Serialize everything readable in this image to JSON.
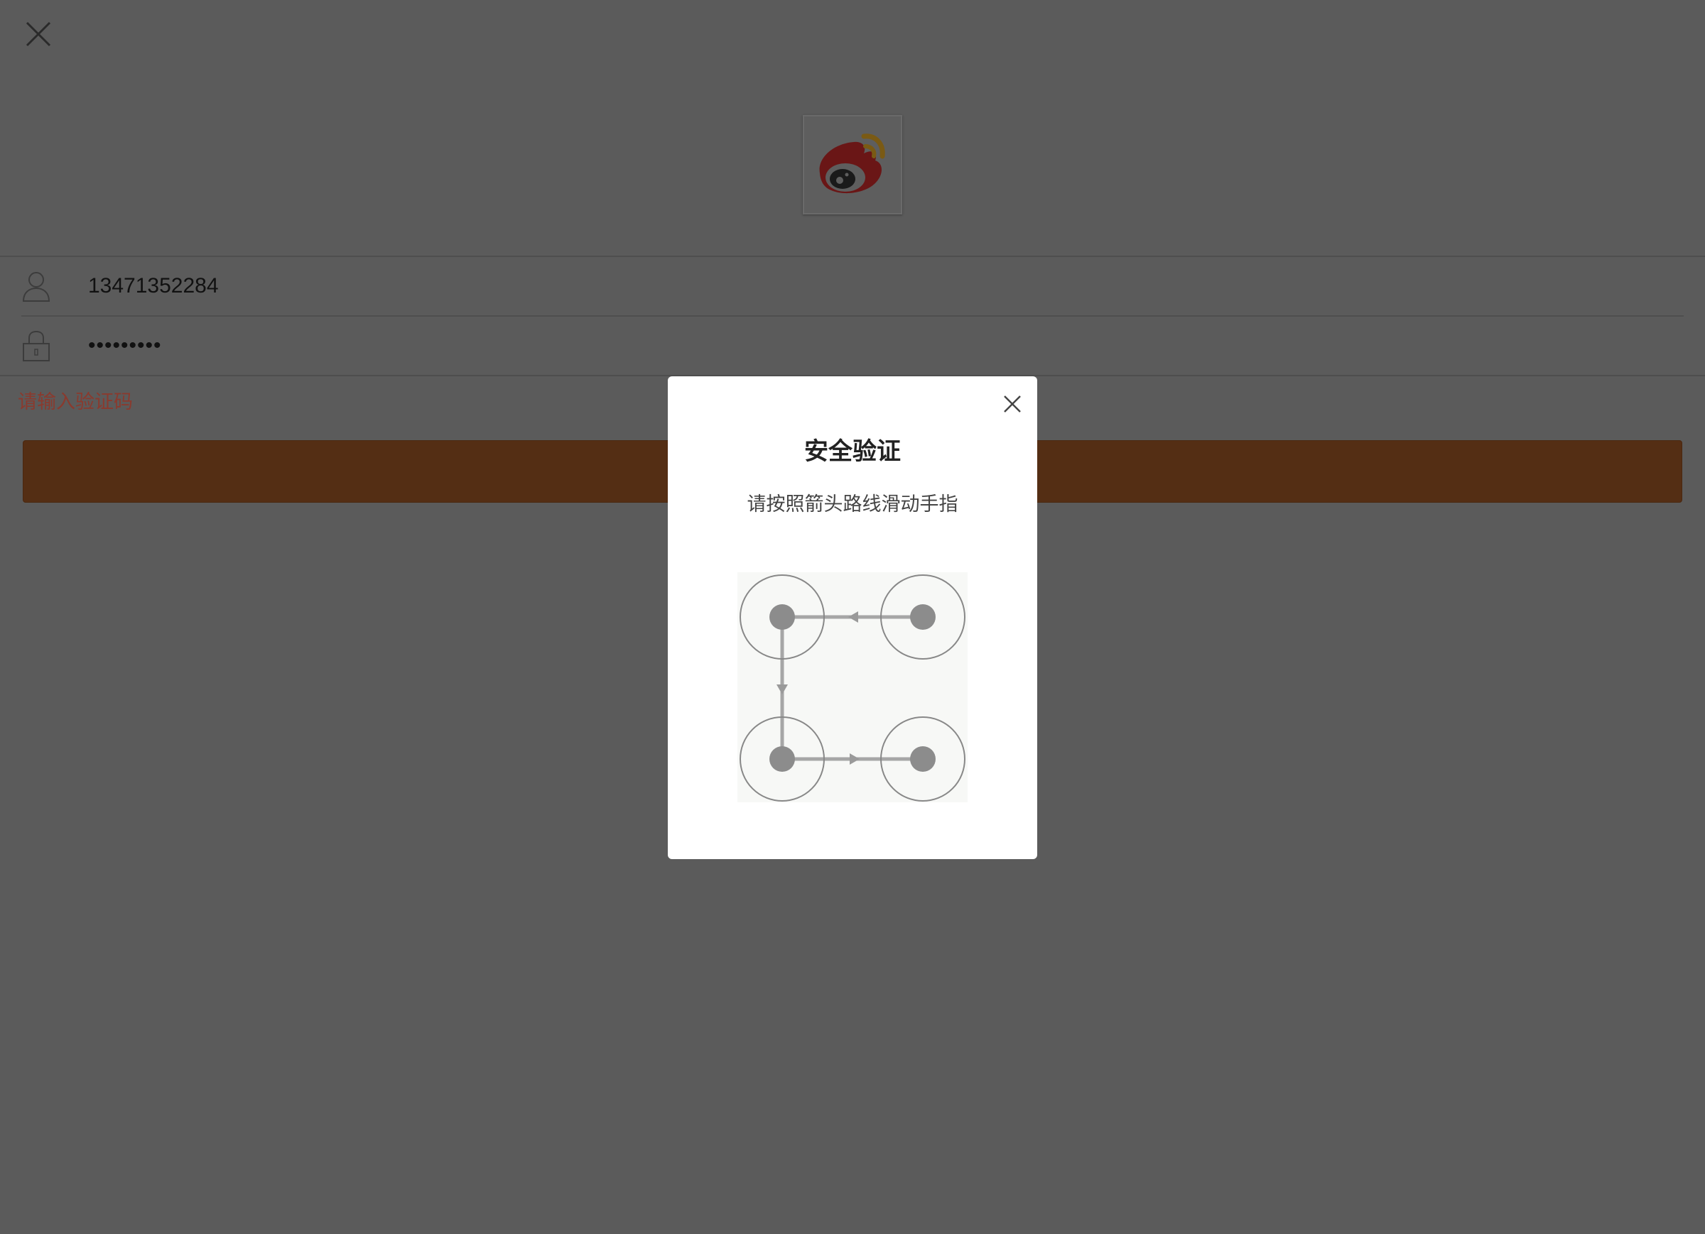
{
  "header": {
    "close_icon": "close-icon",
    "logo_icon": "weibo-logo"
  },
  "form": {
    "username": {
      "icon": "user-icon",
      "value": "13471352284"
    },
    "password": {
      "icon": "lock-icon",
      "value": "•••••••••"
    },
    "captcha_hint": "请输入验证码",
    "submit_label": ""
  },
  "modal": {
    "title": "安全验证",
    "subtitle": "请按照箭头路线滑动手指",
    "close_icon": "close-icon",
    "pattern": {
      "nodes": 4,
      "path": [
        "top-right",
        "top-left",
        "bottom-left",
        "bottom-right"
      ]
    }
  },
  "colors": {
    "overlay_bg": "#5b5b5b",
    "submit_bar": "#542e14",
    "captcha_hint": "#8a3a2e",
    "modal_bg": "#ffffff"
  }
}
